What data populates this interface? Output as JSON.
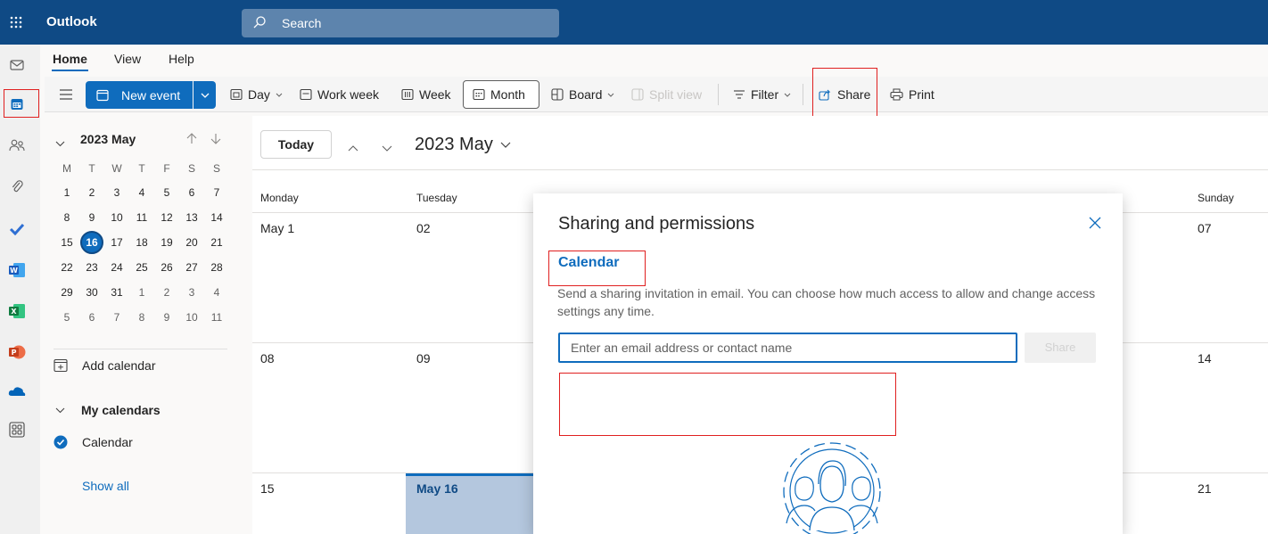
{
  "app": {
    "name": "Outlook"
  },
  "search": {
    "placeholder": "Search"
  },
  "tabs": [
    {
      "label": "Home"
    },
    {
      "label": "View"
    },
    {
      "label": "Help"
    }
  ],
  "ribbon": {
    "new_event": "New event",
    "day": "Day",
    "work_week": "Work week",
    "week": "Week",
    "month": "Month",
    "board": "Board",
    "split_view": "Split view",
    "filter": "Filter",
    "share": "Share",
    "print": "Print"
  },
  "mini_calendar": {
    "title": "2023 May",
    "weekdays": [
      "M",
      "T",
      "W",
      "T",
      "F",
      "S",
      "S"
    ],
    "weeks": [
      [
        "1",
        "2",
        "3",
        "4",
        "5",
        "6",
        "7"
      ],
      [
        "8",
        "9",
        "10",
        "11",
        "12",
        "13",
        "14"
      ],
      [
        "15",
        "16",
        "17",
        "18",
        "19",
        "20",
        "21"
      ],
      [
        "22",
        "23",
        "24",
        "25",
        "26",
        "27",
        "28"
      ],
      [
        "29",
        "30",
        "31",
        "1",
        "2",
        "3",
        "4"
      ],
      [
        "5",
        "6",
        "7",
        "8",
        "9",
        "10",
        "11"
      ]
    ],
    "today": "16"
  },
  "sidebar": {
    "add_calendar": "Add calendar",
    "my_calendars": "My calendars",
    "calendar": "Calendar",
    "show_all": "Show all"
  },
  "main": {
    "today_button": "Today",
    "month_title": "2023 May",
    "day_names": {
      "monday": "Monday",
      "tuesday": "Tuesday",
      "sunday": "Sunday"
    },
    "days": {
      "r1c1": "May 1",
      "r1c2": "02",
      "r1c7": "07",
      "r2c1": "08",
      "r2c2": "09",
      "r2c7": "14",
      "r3c1": "15",
      "r3c2": "May 16",
      "r3c7": "21"
    }
  },
  "modal": {
    "title": "Sharing and permissions",
    "subtitle": "Calendar",
    "description": "Send a sharing invitation in email. You can choose how much access to allow and change access settings any time.",
    "input_placeholder": "Enter an email address or contact name",
    "share_button": "Share"
  },
  "colors": {
    "brand": "#0f4a85",
    "accent": "#0f6cbd",
    "highlight": "#e02020"
  }
}
